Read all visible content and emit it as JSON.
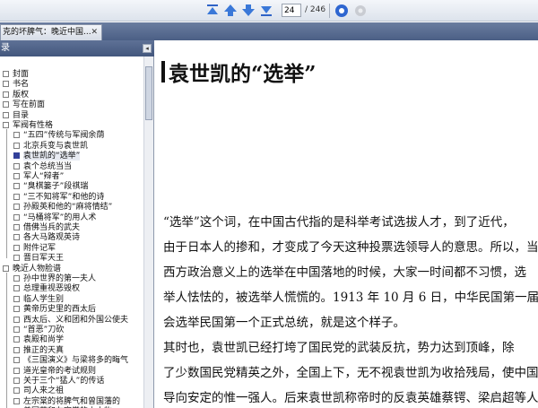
{
  "toolbar": {
    "page_value": "24",
    "page_total": "/ 246",
    "icons": [
      "first-page-icon",
      "prev-page-icon",
      "next-page-icon",
      "last-page-icon",
      "back-icon",
      "forward-icon"
    ]
  },
  "tab": {
    "label": "克的坏脾气：晚近中国...",
    "close": "✕"
  },
  "sidebar": {
    "header": "录",
    "collapse": "◂",
    "items": [
      {
        "label": "封面",
        "level": 0
      },
      {
        "label": "书名",
        "level": 0
      },
      {
        "label": "版权",
        "level": 0
      },
      {
        "label": "写在前面",
        "level": 0
      },
      {
        "label": "目录",
        "level": 0
      },
      {
        "label": "军阀有性格",
        "level": 0
      },
      {
        "label": "“五四”传统与军阀余荫",
        "level": 1
      },
      {
        "label": "北京兵变与袁世凯",
        "level": 1
      },
      {
        "label": "袁世凯的“选举”",
        "level": 1,
        "selected": true
      },
      {
        "label": "袁个总统当当",
        "level": 1
      },
      {
        "label": "军人“辩者”",
        "level": 1
      },
      {
        "label": "“臭棋篓子”段祺瑞",
        "level": 1
      },
      {
        "label": "“三不知将军”和他的诗",
        "level": 1
      },
      {
        "label": "孙殿英和他的“麻将情结”",
        "level": 1
      },
      {
        "label": "“马桶将军”的用人术",
        "level": 1
      },
      {
        "label": "借佛当兵的武夫",
        "level": 1
      },
      {
        "label": "各大马路观英诗",
        "level": 1
      },
      {
        "label": "附件记军",
        "level": 1
      },
      {
        "label": "晋日军天王",
        "level": 1
      },
      {
        "label": "晚近人物脸谱",
        "level": 0
      },
      {
        "label": "孙中世界的第一夫人",
        "level": 1
      },
      {
        "label": "总理重视恶毁权",
        "level": 1
      },
      {
        "label": "临人学生别",
        "level": 1
      },
      {
        "label": "黄帝历史里的西太后",
        "level": 1
      },
      {
        "label": "西太后、义和团和外国公使夫",
        "level": 1
      },
      {
        "label": "“首恶”刀砍",
        "level": 1
      },
      {
        "label": "袁殿和尚学",
        "level": 1
      },
      {
        "label": "推正的天真",
        "level": 1
      },
      {
        "label": "《三国演义》与梁将多的晦气",
        "level": 1
      },
      {
        "label": "道光皇帝的考试规则",
        "level": 1
      },
      {
        "label": "关于三个“猛人”的传话",
        "level": 1
      },
      {
        "label": "司人来之祖",
        "level": 1
      },
      {
        "label": "左宗棠的将脾气和曾国藩的",
        "level": 1
      },
      {
        "label": "曾国藩和左宗棠的小人物",
        "level": 1
      }
    ]
  },
  "document": {
    "title": "袁世凯的“选举”",
    "paragraph1": [
      "“选举”这个词，在中国古代指的是科举考试选拔人才，到了近代，",
      "由于日本人的掺和，才变成了今天这种投票选领导人的意思。所以，当",
      "西方政治意义上的选举在中国落地的时候，大家一时间都不习惯，选",
      "举人怯怯的，被选举人慌慌的。1913 年 10 月 6 日，中华民国第一届国",
      "会选举民国第一个正式总统，就是这个样子。"
    ],
    "paragraph2": [
      "其时也，袁世凯已经打垮了国民党的武装反抗，势力达到顶峰，除",
      "了少数国民党精英之外，全国上下，无不视袁世凯为收拾残局，使中国",
      "导向安定的惟一强人。后来袁世凯称帝时的反袁英雄蔡锷、梁启超等人，"
    ]
  }
}
